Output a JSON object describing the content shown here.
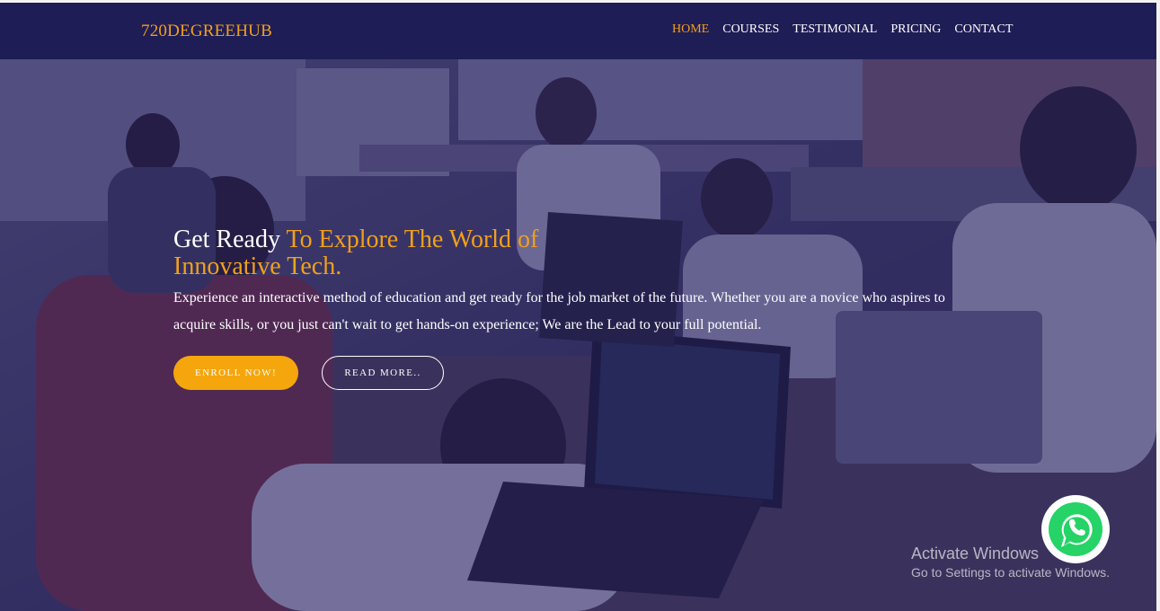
{
  "brand": {
    "name": "720DEGREEHUB"
  },
  "nav": {
    "items": [
      {
        "label": "HOME",
        "active": true
      },
      {
        "label": "COURSES",
        "active": false
      },
      {
        "label": "TESTIMONIAL",
        "active": false
      },
      {
        "label": "PRICING",
        "active": false
      },
      {
        "label": "CONTACT",
        "active": false
      }
    ]
  },
  "hero": {
    "heading_plain": "Get Ready ",
    "heading_accent": "To Explore The World of Innovative Tech.",
    "description": "Experience an interactive method of education and get ready for the job market of the future.  Whether you are a novice who aspires to acquire skills, or you just can't wait to get hands-on experience; We are the Lead to your full potential.",
    "enroll_label": "ENROLL NOW!",
    "read_more_label": "READ MORE.."
  },
  "whatsapp": {
    "icon": "whatsapp-icon",
    "color": "#25d366"
  },
  "watermark": {
    "title": "Activate Windows",
    "subtitle": "Go to Settings to activate Windows."
  },
  "colors": {
    "navbar": "#1f1d55",
    "accent": "#f0a01c",
    "button": "#f5a60d",
    "overlay": "#201c60"
  }
}
